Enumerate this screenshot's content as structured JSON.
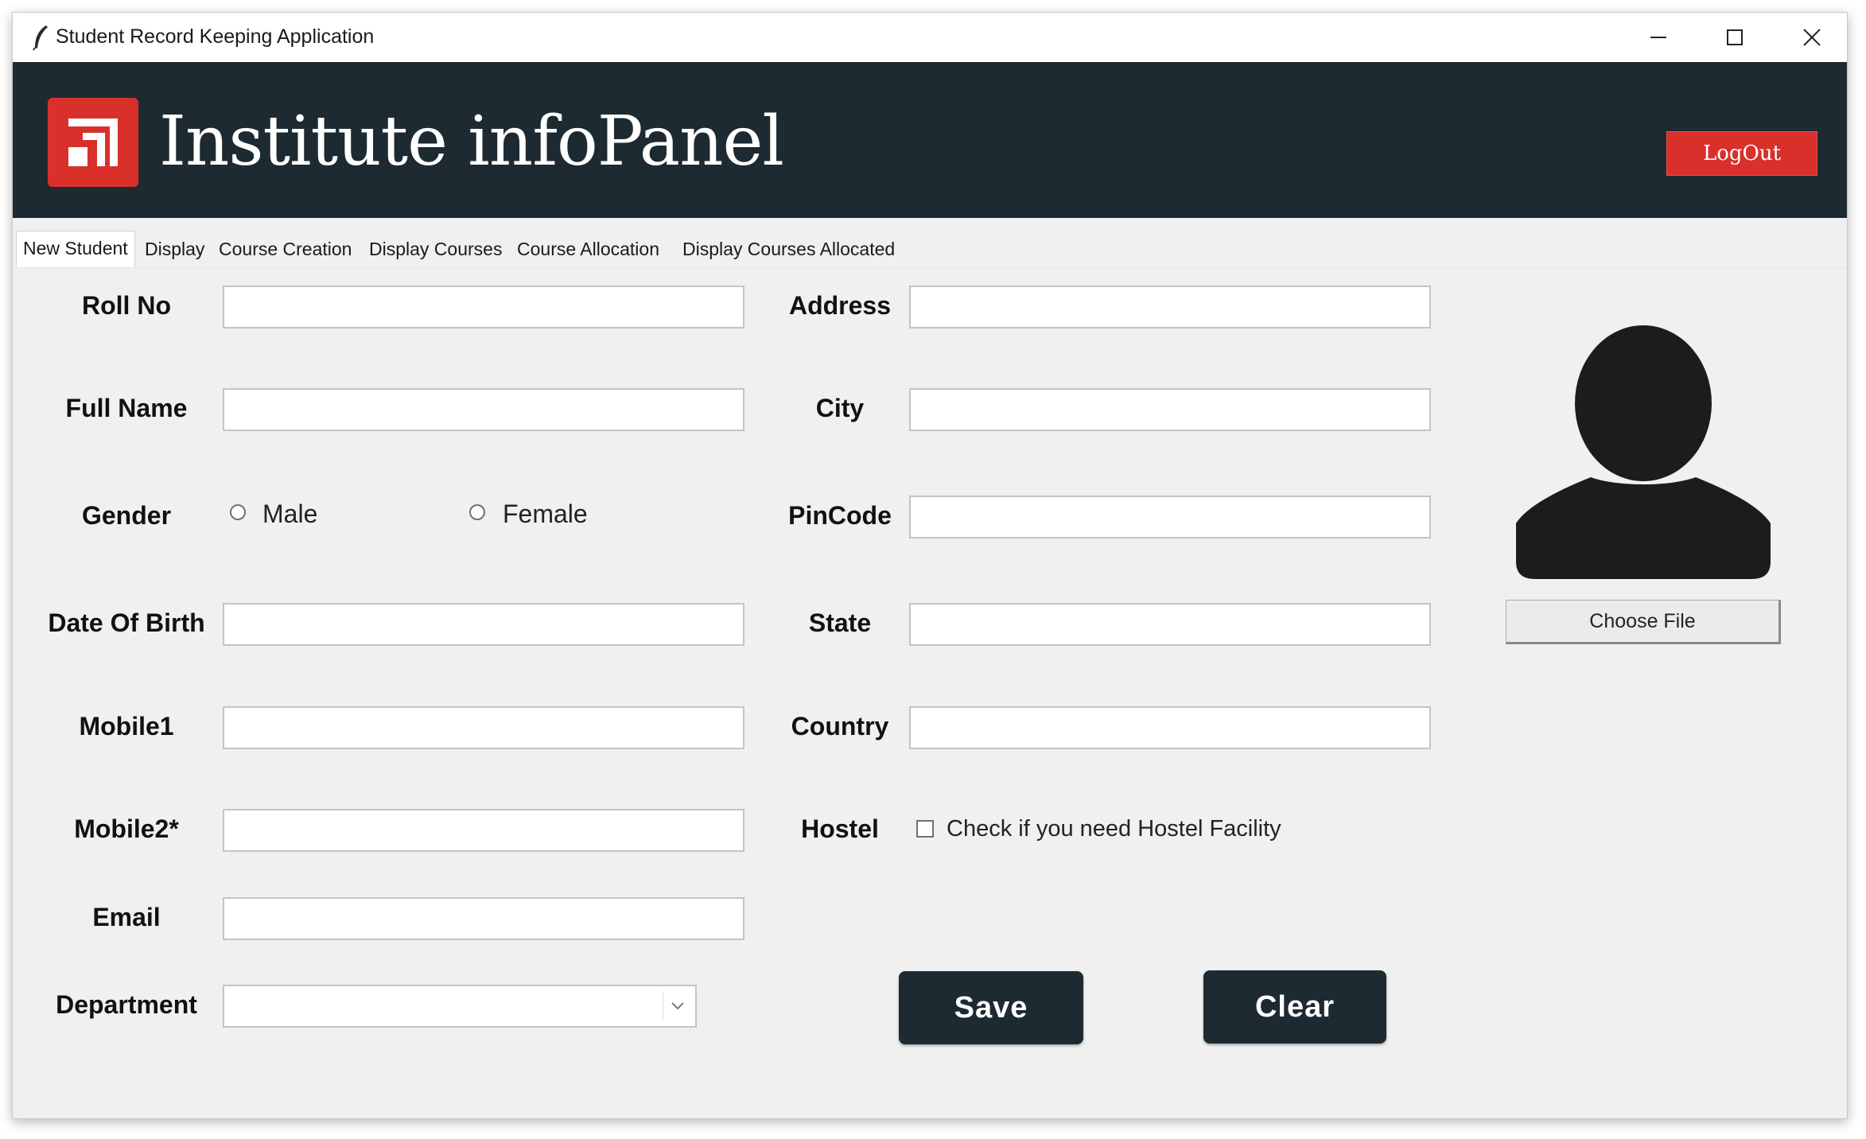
{
  "window": {
    "title": "Student Record Keeping Application",
    "controls": [
      "minimize-icon",
      "maximize-icon",
      "close-icon"
    ]
  },
  "header": {
    "brand": "Institute infoPanel",
    "logout_label": "LogOut",
    "colors": {
      "band": "#1e2a31",
      "accent": "#d9302c"
    }
  },
  "tabs": [
    {
      "label": "New Student",
      "active": true
    },
    {
      "label": "Display",
      "active": false
    },
    {
      "label": "Course Creation",
      "active": false
    },
    {
      "label": "Display Courses",
      "active": false
    },
    {
      "label": "Course Allocation",
      "active": false
    },
    {
      "label": "Display Courses Allocated",
      "active": false
    }
  ],
  "form": {
    "roll_no": {
      "label": "Roll No",
      "value": ""
    },
    "full_name": {
      "label": "Full Name",
      "value": ""
    },
    "gender": {
      "label": "Gender",
      "options": [
        "Male",
        "Female"
      ],
      "selected": null
    },
    "dob": {
      "label": "Date Of Birth",
      "value": ""
    },
    "mobile1": {
      "label": "Mobile1",
      "value": ""
    },
    "mobile2": {
      "label": "Mobile2*",
      "value": ""
    },
    "email": {
      "label": "Email",
      "value": ""
    },
    "department": {
      "label": "Department",
      "value": ""
    },
    "address": {
      "label": "Address",
      "value": ""
    },
    "city": {
      "label": "City",
      "value": ""
    },
    "pincode": {
      "label": "PinCode",
      "value": ""
    },
    "state": {
      "label": "State",
      "value": ""
    },
    "country": {
      "label": "Country",
      "value": ""
    },
    "hostel": {
      "label": "Hostel",
      "checkbox_text": "Check if you need Hostel Facility",
      "checked": false
    }
  },
  "photo": {
    "icon": "user-avatar-icon",
    "choose_label": "Choose File"
  },
  "actions": {
    "save_label": "Save",
    "clear_label": "Clear"
  }
}
